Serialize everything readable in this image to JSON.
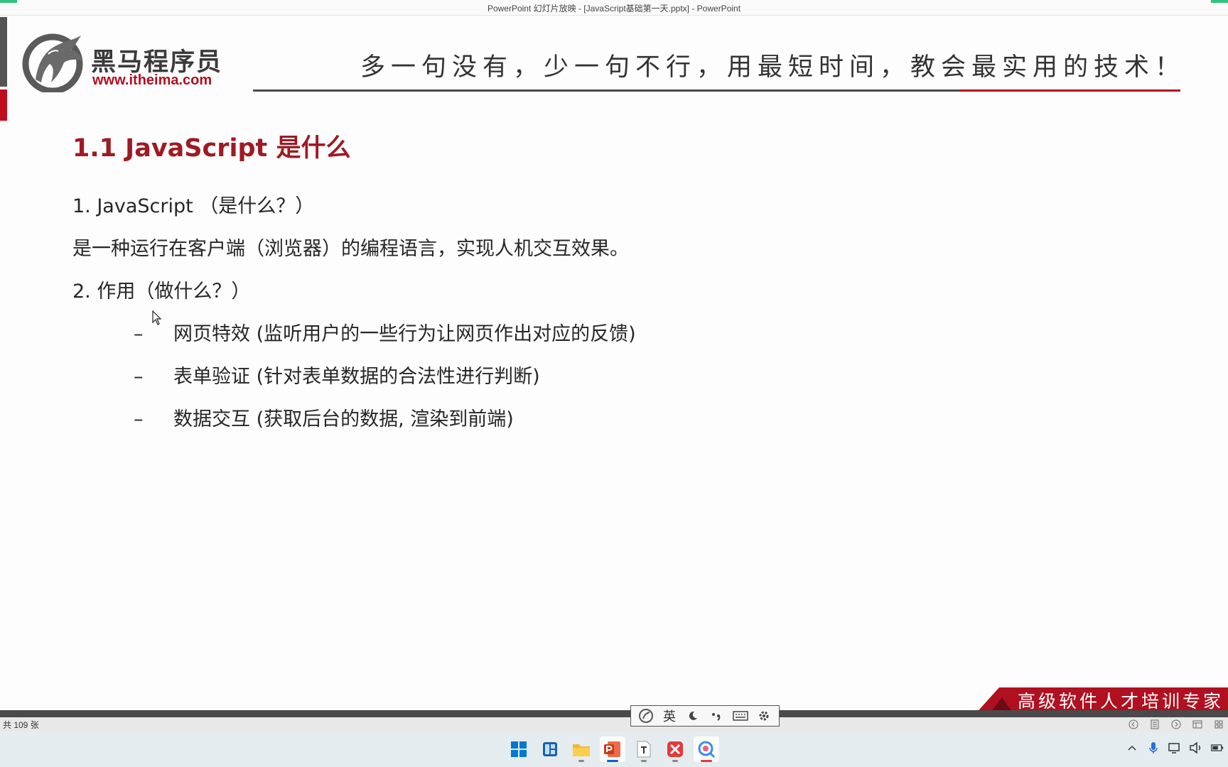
{
  "window": {
    "title": "PowerPoint 幻灯片放映 - [JavaScript基础第一天.pptx] - PowerPoint"
  },
  "slide": {
    "logo": {
      "name_cn": "黑马程序员",
      "url": "www.itheima.com"
    },
    "slogan": "多一句没有，少一句不行，用最短时间，教会最实用的技术！",
    "title": "1.1 JavaScript 是什么",
    "lines": [
      "1. JavaScript （是什么？）",
      "是一种运行在客户端（浏览器）的编程语言，实现人机交互效果。",
      "2. 作用（做什么？）"
    ],
    "bullets": [
      "网页特效 (监听用户的一些行为让网页作出对应的反馈)",
      "表单验证 (针对表单数据的合法性进行判断)",
      "数据交互 (获取后台的数据, 渲染到前端)"
    ],
    "bullet_marker": "–",
    "footer_banner": "高级软件人才培训专家",
    "colors": {
      "brand_red": "#b01020",
      "title_red": "#9e1b24",
      "dark_gray": "#4a4a4a"
    }
  },
  "statusbar": {
    "slide_count": "共 109 张",
    "icons": [
      "prev-icon",
      "notes-icon",
      "next-icon",
      "normal-view-icon",
      "slide-sorter-icon"
    ]
  },
  "ime": {
    "mode_label": "英",
    "icons": [
      "ime-logo-icon",
      "moon-icon",
      "punctuation-icon",
      "keyboard-icon",
      "settings-icon"
    ]
  },
  "taskbar": {
    "apps": [
      "start-icon",
      "widgets-icon",
      "file-explorer-icon",
      "powerpoint-icon",
      "typora-icon",
      "xmind-icon",
      "screen-recorder-icon"
    ],
    "tray_icons": [
      "chevron-up-icon",
      "microphone-icon",
      "network-icon",
      "volume-icon",
      "battery-icon"
    ]
  }
}
